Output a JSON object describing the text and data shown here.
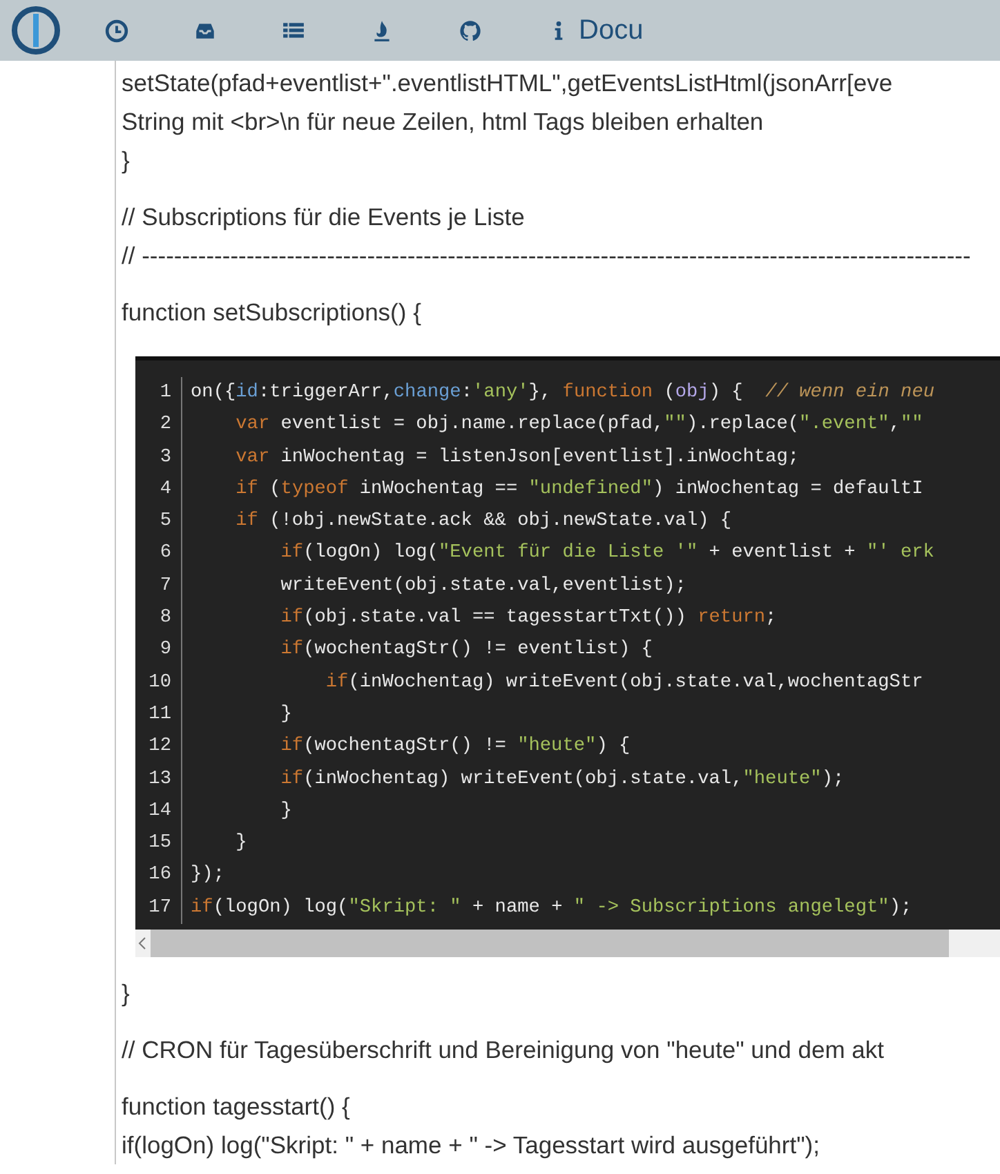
{
  "nav_items": [
    {
      "kind": "clock"
    },
    {
      "kind": "inbox"
    },
    {
      "kind": "list"
    },
    {
      "kind": "flame"
    },
    {
      "kind": "github"
    },
    {
      "kind": "info",
      "label": "Docu"
    }
  ],
  "blocks": [
    {
      "kind": "paragraph",
      "lines": [
        "setState(pfad+eventlist+\".eventlistHTML\",getEventsListHtml(jsonArr[eve",
        "String mit <br>\\n für neue Zeilen, html Tags bleiben erhalten",
        "}"
      ]
    },
    {
      "kind": "paragraph",
      "lines": [
        "// Subscriptions für die Events je Liste",
        "// -------------------------------------------------------------------------------------------------------"
      ]
    },
    {
      "kind": "paragraph",
      "lines": [
        "function setSubscriptions() {"
      ]
    },
    {
      "kind": "code",
      "lines": [
        {
          "number": "1",
          "tokens": [
            {
              "kind": "plain",
              "text": "on({"
            },
            {
              "kind": "property",
              "text": "id"
            },
            {
              "kind": "plain",
              "text": ":triggerArr,"
            },
            {
              "kind": "property",
              "text": "change"
            },
            {
              "kind": "plain",
              "text": ":"
            },
            {
              "kind": "string",
              "text": "'any'"
            },
            {
              "kind": "plain",
              "text": "}, "
            },
            {
              "kind": "keyword",
              "text": "function"
            },
            {
              "kind": "plain",
              "text": " ("
            },
            {
              "kind": "param",
              "text": "obj"
            },
            {
              "kind": "plain",
              "text": ") {  "
            },
            {
              "kind": "comment",
              "text": "// wenn ein neu"
            }
          ]
        },
        {
          "number": "2",
          "tokens": [
            {
              "kind": "keyword",
              "text": "    var"
            },
            {
              "kind": "plain",
              "text": " eventlist = obj.name.replace(pfad,"
            },
            {
              "kind": "string",
              "text": "\"\""
            },
            {
              "kind": "plain",
              "text": ").replace("
            },
            {
              "kind": "string",
              "text": "\".event\""
            },
            {
              "kind": "plain",
              "text": ","
            },
            {
              "kind": "string",
              "text": "\"\""
            }
          ]
        },
        {
          "number": "3",
          "tokens": [
            {
              "kind": "keyword",
              "text": "    var"
            },
            {
              "kind": "plain",
              "text": " inWochentag = listenJson[eventlist].inWochtag;"
            }
          ]
        },
        {
          "number": "4",
          "tokens": [
            {
              "kind": "keyword",
              "text": "    if"
            },
            {
              "kind": "plain",
              "text": " ("
            },
            {
              "kind": "keyword",
              "text": "typeof"
            },
            {
              "kind": "plain",
              "text": " inWochentag == "
            },
            {
              "kind": "string",
              "text": "\"undefined\""
            },
            {
              "kind": "plain",
              "text": ") inWochentag = defaultI"
            }
          ]
        },
        {
          "number": "5",
          "tokens": [
            {
              "kind": "keyword",
              "text": "    if"
            },
            {
              "kind": "plain",
              "text": " (!obj.newState.ack && obj.newState.val) {"
            }
          ]
        },
        {
          "number": "6",
          "tokens": [
            {
              "kind": "keyword",
              "text": "        if"
            },
            {
              "kind": "plain",
              "text": "(logOn) log("
            },
            {
              "kind": "string",
              "text": "\"Event für die Liste '\""
            },
            {
              "kind": "plain",
              "text": " + eventlist + "
            },
            {
              "kind": "string",
              "text": "\"' erk"
            }
          ]
        },
        {
          "number": "7",
          "tokens": [
            {
              "kind": "plain",
              "text": "        writeEvent(obj.state.val,eventlist);"
            }
          ]
        },
        {
          "number": "8",
          "tokens": [
            {
              "kind": "keyword",
              "text": "        if"
            },
            {
              "kind": "plain",
              "text": "(obj.state.val == tagesstartTxt()) "
            },
            {
              "kind": "keyword",
              "text": "return"
            },
            {
              "kind": "plain",
              "text": ";"
            }
          ]
        },
        {
          "number": "9",
          "tokens": [
            {
              "kind": "keyword",
              "text": "        if"
            },
            {
              "kind": "plain",
              "text": "(wochentagStr() != eventlist) {"
            }
          ]
        },
        {
          "number": "10",
          "tokens": [
            {
              "kind": "keyword",
              "text": "            if"
            },
            {
              "kind": "plain",
              "text": "(inWochentag) writeEvent(obj.state.val,wochentagStr"
            }
          ]
        },
        {
          "number": "11",
          "tokens": [
            {
              "kind": "plain",
              "text": "        }"
            }
          ]
        },
        {
          "number": "12",
          "tokens": [
            {
              "kind": "keyword",
              "text": "        if"
            },
            {
              "kind": "plain",
              "text": "(wochentagStr() != "
            },
            {
              "kind": "string",
              "text": "\"heute\""
            },
            {
              "kind": "plain",
              "text": ") {"
            }
          ]
        },
        {
          "number": "13",
          "tokens": [
            {
              "kind": "keyword",
              "text": "        if"
            },
            {
              "kind": "plain",
              "text": "(inWochentag) writeEvent(obj.state.val,"
            },
            {
              "kind": "string",
              "text": "\"heute\""
            },
            {
              "kind": "plain",
              "text": ");"
            }
          ]
        },
        {
          "number": "14",
          "tokens": [
            {
              "kind": "plain",
              "text": "        }"
            }
          ]
        },
        {
          "number": "15",
          "tokens": [
            {
              "kind": "plain",
              "text": "    }"
            }
          ]
        },
        {
          "number": "16",
          "tokens": [
            {
              "kind": "plain",
              "text": "});"
            }
          ]
        },
        {
          "number": "17",
          "tokens": [
            {
              "kind": "keyword",
              "text": "if"
            },
            {
              "kind": "plain",
              "text": "(logOn) log("
            },
            {
              "kind": "string",
              "text": "\"Skript: \""
            },
            {
              "kind": "plain",
              "text": " + name + "
            },
            {
              "kind": "string",
              "text": "\" -> Subscriptions angelegt\""
            },
            {
              "kind": "plain",
              "text": ");"
            }
          ]
        }
      ]
    },
    {
      "kind": "paragraph",
      "lines": [
        "}"
      ]
    },
    {
      "kind": "paragraph",
      "lines": [
        "// CRON für Tagesüberschrift und Bereinigung von \"heute\" und dem akt"
      ]
    },
    {
      "kind": "paragraph",
      "lines": [
        "function tagesstart() {",
        "if(logOn) log(\"Skript: \" + name + \" -> Tagesstart wird ausgeführt\");"
      ]
    }
  ]
}
